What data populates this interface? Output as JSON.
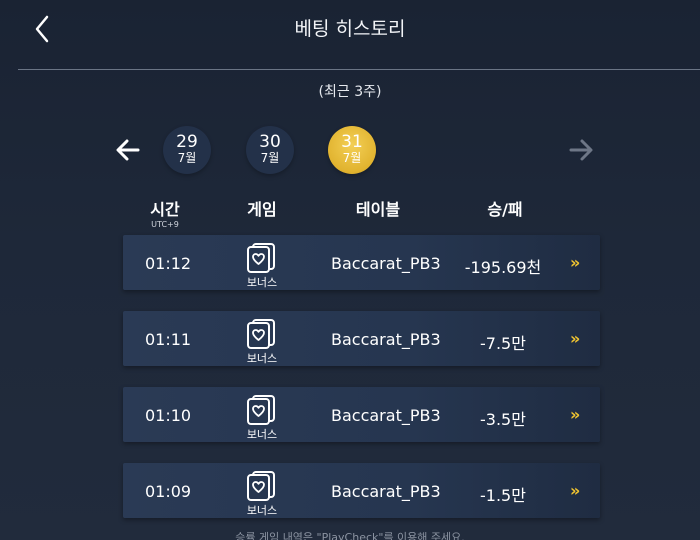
{
  "header": {
    "title": "베팅 히스토리",
    "back_icon": "chevron-left-icon"
  },
  "subtitle": "(최근 3주)",
  "date_nav": {
    "prev_icon": "arrow-left-icon",
    "next_icon": "arrow-right-icon",
    "next_enabled": false,
    "days": [
      {
        "day": "29",
        "month": "7월",
        "selected": false
      },
      {
        "day": "30",
        "month": "7월",
        "selected": false
      },
      {
        "day": "31",
        "month": "7월",
        "selected": true
      }
    ]
  },
  "columns": {
    "time": "시간",
    "timezone": "UTC+9",
    "game": "게임",
    "table": "테이블",
    "result": "승/패"
  },
  "rows": [
    {
      "time": "01:12",
      "game": "보너스",
      "table": "Baccarat_PB3",
      "result": "-195.69천",
      "more": "»"
    },
    {
      "time": "01:11",
      "game": "보너스",
      "table": "Baccarat_PB3",
      "result": "-7.5만",
      "more": "»"
    },
    {
      "time": "01:10",
      "game": "보너스",
      "table": "Baccarat_PB3",
      "result": "-3.5만",
      "more": "»"
    },
    {
      "time": "01:09",
      "game": "보너스",
      "table": "Baccarat_PB3",
      "result": "-1.5만",
      "more": "»"
    }
  ],
  "footer_note": "승률 게임 내역은 \"PlayCheck\"를 이용해 주세요.",
  "colors": {
    "accent_gold": "#f0c430",
    "row_bg": "#263650",
    "page_bg": "#1e2839",
    "disabled_arrow": "#6e7787"
  }
}
